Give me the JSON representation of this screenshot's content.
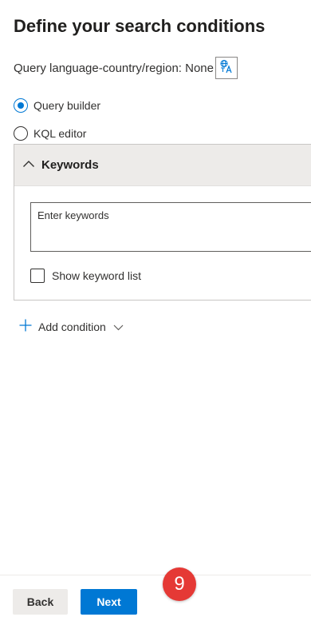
{
  "page": {
    "title": "Define your search conditions"
  },
  "language": {
    "label": "Query language-country/region: None",
    "icon": "language-translate-icon"
  },
  "query_mode": {
    "options": [
      {
        "label": "Query builder",
        "selected": true
      },
      {
        "label": "KQL editor",
        "selected": false
      }
    ]
  },
  "keywords_section": {
    "header": "Keywords",
    "input_placeholder": "Enter keywords",
    "show_list_label": "Show keyword list",
    "show_list_checked": false
  },
  "add_condition": {
    "label": "Add condition"
  },
  "footer": {
    "back_label": "Back",
    "next_label": "Next"
  },
  "step_badge": {
    "number": "9"
  },
  "colors": {
    "accent": "#0078d4",
    "badge": "#e53935"
  }
}
